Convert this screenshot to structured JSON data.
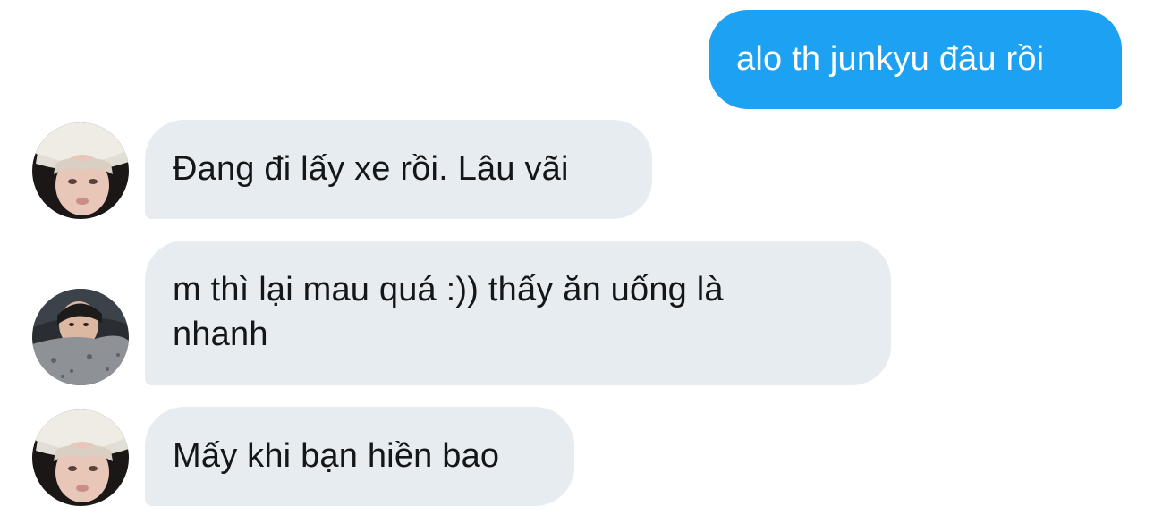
{
  "conversation": {
    "messages": [
      {
        "direction": "outgoing",
        "text": "alo th junkyu đâu rồi"
      },
      {
        "direction": "incoming",
        "avatar": "white-bucket-hat-avatar",
        "text": "Đang đi lấy xe rồi. Lâu vãi"
      },
      {
        "direction": "incoming",
        "avatar": "car-selfie-avatar",
        "text": "m thì lại mau quá :)) thấy ăn uống là nhanh"
      },
      {
        "direction": "incoming",
        "avatar": "white-bucket-hat-avatar",
        "text": "Mấy khi bạn hiền bao"
      }
    ]
  },
  "colors": {
    "outgoing_bubble": "#1da1f2",
    "incoming_bubble": "#e6ecf0",
    "incoming_text": "#14171a",
    "outgoing_text": "#ffffff"
  }
}
